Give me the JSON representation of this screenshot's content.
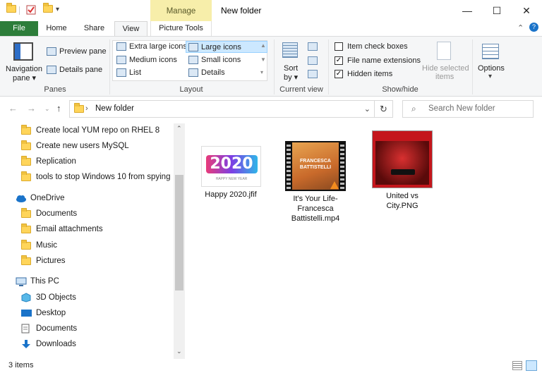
{
  "window": {
    "title": "New folder",
    "manage_label": "Manage",
    "minimize": "—",
    "maximize": "☐",
    "close": "✕"
  },
  "tabs": [
    {
      "label": "File"
    },
    {
      "label": "Home"
    },
    {
      "label": "Share"
    },
    {
      "label": "View"
    },
    {
      "label": "Picture Tools"
    }
  ],
  "ribbon": {
    "panes": {
      "nav_pane_label_1": "Navigation",
      "nav_pane_label_2": "pane",
      "preview_pane": "Preview pane",
      "details_pane": "Details pane",
      "group_label": "Panes"
    },
    "layout": {
      "options": [
        "Extra large icons",
        "Large icons",
        "Medium icons",
        "Small icons",
        "List",
        "Details"
      ],
      "selected": "Large icons",
      "group_label": "Layout"
    },
    "current_view": {
      "sort_label_1": "Sort",
      "sort_label_2": "by",
      "group_label": "Current view"
    },
    "show_hide": {
      "item_check_boxes": "Item check boxes",
      "file_name_extensions": "File name extensions",
      "hidden_items": "Hidden items",
      "item_check_boxes_checked": false,
      "file_name_extensions_checked": true,
      "hidden_items_checked": true,
      "hide_selected_1": "Hide selected",
      "hide_selected_2": "items",
      "group_label": "Show/hide"
    },
    "options": {
      "label": "Options"
    }
  },
  "address": {
    "path": "New folder",
    "search_placeholder": "Search New folder"
  },
  "nav": {
    "folders_top": [
      "Create local YUM repo on RHEL 8",
      "Create new users MySQL",
      "Replication",
      "tools to stop Windows 10 from spying"
    ],
    "onedrive": "OneDrive",
    "onedrive_items": [
      "Documents",
      "Email attachments",
      "Music",
      "Pictures"
    ],
    "thispc": "This PC",
    "thispc_items": [
      "3D Objects",
      "Desktop",
      "Documents",
      "Downloads"
    ]
  },
  "files": [
    {
      "name": "Happy 2020.jfif",
      "thumb_text": "2020",
      "thumb_sub": "HAPPY NEW YEAR"
    },
    {
      "name": "It's Your Life-Francesca Battistelli.mp4",
      "name_lines": [
        "It's Your Life-",
        "Francesca",
        "Battistelli.mp4"
      ],
      "thumb_text": "FRANCESCA BATTISTELLI"
    },
    {
      "name": "United vs City.PNG",
      "name_lines": [
        "United vs",
        "City.PNG"
      ]
    }
  ],
  "status": {
    "count": "3 items"
  },
  "colors": {
    "file_tab": "#2d7d3a",
    "manage": "#f7eeaa",
    "selection": "#cce8ff",
    "folder": "#ffd55a"
  }
}
